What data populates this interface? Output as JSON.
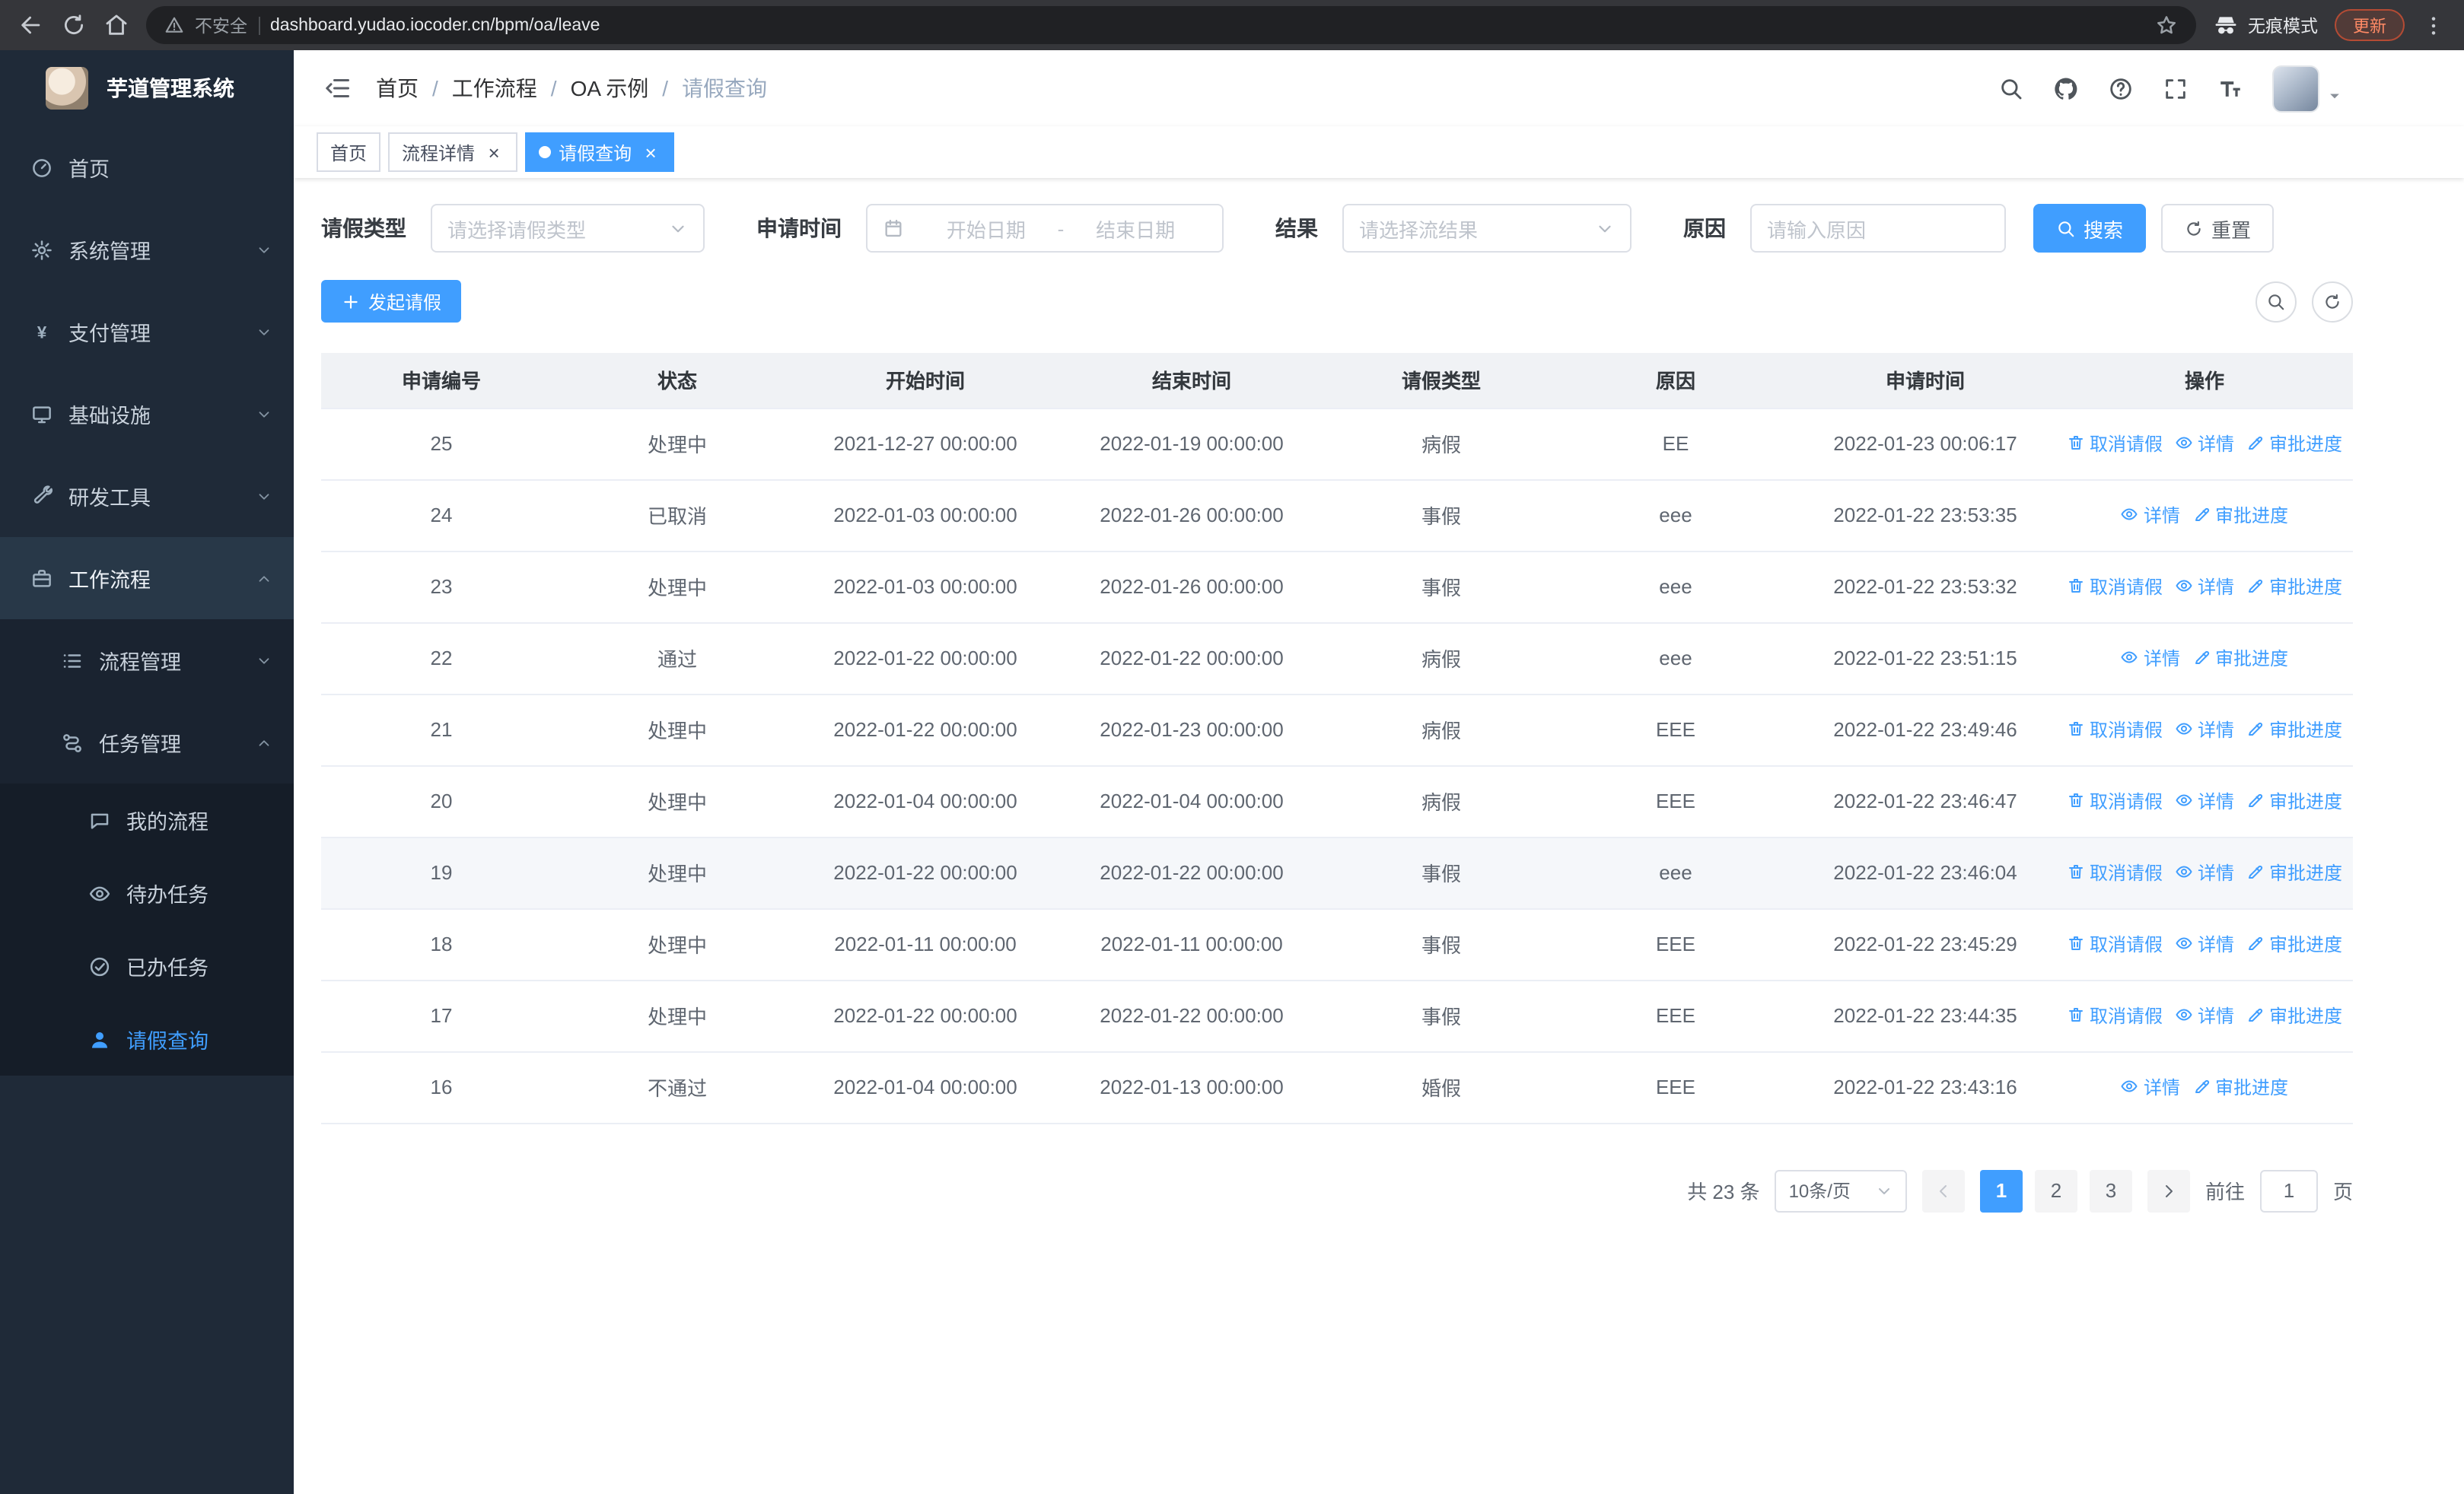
{
  "colors": {
    "accent": "#409eff",
    "sidebar_bg": "#1f2a38",
    "table_header_bg": "#f0f2f5",
    "link": "#409eff",
    "tag_active_bg": "#409eff"
  },
  "ui": {
    "close_symbol": "×"
  },
  "browser": {
    "security_warning": "不安全",
    "url": "dashboard.yudao.iocoder.cn/bpm/oa/leave",
    "incognito_label": "无痕模式",
    "update_button": "更新"
  },
  "sidebar": {
    "logo_title": "芋道管理系统",
    "items": [
      {
        "id": "home",
        "label": "首页",
        "icon": "dashboard-icon",
        "level": 1
      },
      {
        "id": "system",
        "label": "系统管理",
        "icon": "gear-icon",
        "level": 1,
        "expandable": true,
        "expanded": false
      },
      {
        "id": "payment",
        "label": "支付管理",
        "icon": "yen-icon",
        "level": 1,
        "expandable": true,
        "expanded": false
      },
      {
        "id": "infra",
        "label": "基础设施",
        "icon": "infra-icon",
        "level": 1,
        "expandable": true,
        "expanded": false
      },
      {
        "id": "devtools",
        "label": "研发工具",
        "icon": "tools-icon",
        "level": 1,
        "expandable": true,
        "expanded": false
      },
      {
        "id": "workflow",
        "label": "工作流程",
        "icon": "briefcase-icon",
        "level": 1,
        "expandable": true,
        "expanded": true,
        "open": true
      },
      {
        "id": "process-mgmt",
        "label": "流程管理",
        "icon": "list-icon",
        "level": 2,
        "expandable": true,
        "expanded": false
      },
      {
        "id": "task-mgmt",
        "label": "任务管理",
        "icon": "route-icon",
        "level": 2,
        "expandable": true,
        "expanded": true
      },
      {
        "id": "my-process",
        "label": "我的流程",
        "icon": "chat-icon",
        "level": 3
      },
      {
        "id": "todo-task",
        "label": "待办任务",
        "icon": "eye-icon",
        "level": 3
      },
      {
        "id": "done-task",
        "label": "已办任务",
        "icon": "check-icon",
        "level": 3
      },
      {
        "id": "leave-query",
        "label": "请假查询",
        "icon": "user-icon",
        "level": 3,
        "active": true
      }
    ]
  },
  "header": {
    "breadcrumb": [
      "首页",
      "工作流程",
      "OA 示例",
      "请假查询"
    ],
    "separator": "/"
  },
  "tabs": [
    {
      "id": "home",
      "label": "首页",
      "closable": false,
      "active": false
    },
    {
      "id": "process-detail",
      "label": "流程详情",
      "closable": true,
      "active": false
    },
    {
      "id": "leave-query",
      "label": "请假查询",
      "closable": true,
      "active": true
    }
  ],
  "filters": {
    "leave_type_label": "请假类型",
    "leave_type_placeholder": "请选择请假类型",
    "apply_time_label": "申请时间",
    "start_date_placeholder": "开始日期",
    "range_separator": "-",
    "end_date_placeholder": "结束日期",
    "result_label": "结果",
    "result_placeholder": "请选择流结果",
    "reason_label": "原因",
    "reason_placeholder": "请输入原因",
    "search_button": "搜索",
    "reset_button": "重置"
  },
  "toolbar": {
    "create_button": "发起请假"
  },
  "table": {
    "columns": [
      "申请编号",
      "状态",
      "开始时间",
      "结束时间",
      "请假类型",
      "原因",
      "申请时间",
      "操作"
    ],
    "actions": {
      "cancel": "取消请假",
      "detail": "详情",
      "progress": "审批进度"
    },
    "rows": [
      {
        "id": "25",
        "status": "处理中",
        "start": "2021-12-27 00:00:00",
        "end": "2022-01-19 00:00:00",
        "type": "病假",
        "reason": "EE",
        "applied": "2022-01-23 00:06:17",
        "can_cancel": true,
        "highlight": false
      },
      {
        "id": "24",
        "status": "已取消",
        "start": "2022-01-03 00:00:00",
        "end": "2022-01-26 00:00:00",
        "type": "事假",
        "reason": "eee",
        "applied": "2022-01-22 23:53:35",
        "can_cancel": false,
        "highlight": false
      },
      {
        "id": "23",
        "status": "处理中",
        "start": "2022-01-03 00:00:00",
        "end": "2022-01-26 00:00:00",
        "type": "事假",
        "reason": "eee",
        "applied": "2022-01-22 23:53:32",
        "can_cancel": true,
        "highlight": false
      },
      {
        "id": "22",
        "status": "通过",
        "start": "2022-01-22 00:00:00",
        "end": "2022-01-22 00:00:00",
        "type": "病假",
        "reason": "eee",
        "applied": "2022-01-22 23:51:15",
        "can_cancel": false,
        "highlight": false
      },
      {
        "id": "21",
        "status": "处理中",
        "start": "2022-01-22 00:00:00",
        "end": "2022-01-23 00:00:00",
        "type": "病假",
        "reason": "EEE",
        "applied": "2022-01-22 23:49:46",
        "can_cancel": true,
        "highlight": false
      },
      {
        "id": "20",
        "status": "处理中",
        "start": "2022-01-04 00:00:00",
        "end": "2022-01-04 00:00:00",
        "type": "病假",
        "reason": "EEE",
        "applied": "2022-01-22 23:46:47",
        "can_cancel": true,
        "highlight": false
      },
      {
        "id": "19",
        "status": "处理中",
        "start": "2022-01-22 00:00:00",
        "end": "2022-01-22 00:00:00",
        "type": "事假",
        "reason": "eee",
        "applied": "2022-01-22 23:46:04",
        "can_cancel": true,
        "highlight": true
      },
      {
        "id": "18",
        "status": "处理中",
        "start": "2022-01-11 00:00:00",
        "end": "2022-01-11 00:00:00",
        "type": "事假",
        "reason": "EEE",
        "applied": "2022-01-22 23:45:29",
        "can_cancel": true,
        "highlight": false
      },
      {
        "id": "17",
        "status": "处理中",
        "start": "2022-01-22 00:00:00",
        "end": "2022-01-22 00:00:00",
        "type": "事假",
        "reason": "EEE",
        "applied": "2022-01-22 23:44:35",
        "can_cancel": true,
        "highlight": false
      },
      {
        "id": "16",
        "status": "不通过",
        "start": "2022-01-04 00:00:00",
        "end": "2022-01-13 00:00:00",
        "type": "婚假",
        "reason": "EEE",
        "applied": "2022-01-22 23:43:16",
        "can_cancel": false,
        "highlight": false
      }
    ]
  },
  "pagination": {
    "total_text": "共 23 条",
    "page_size": "10条/页",
    "pages": [
      "1",
      "2",
      "3"
    ],
    "current_page": "1",
    "goto_label": "前往",
    "goto_value": "1",
    "goto_suffix": "页"
  }
}
